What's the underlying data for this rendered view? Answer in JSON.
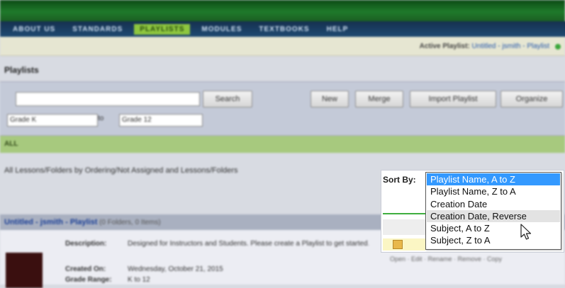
{
  "nav": {
    "items": [
      "ABOUT US",
      "STANDARDS",
      "PLAYLISTS",
      "MODULES",
      "TEXTBOOKS",
      "HELP"
    ],
    "active_index": 2
  },
  "statusbar": {
    "label": "Active Playlist:",
    "value": "Untitled - jsmith - Playlist"
  },
  "page": {
    "heading": "Playlists"
  },
  "search": {
    "input_value": "",
    "search_button": "Search",
    "buttons": [
      "New",
      "Merge",
      "Import Playlist",
      "Organize"
    ],
    "from_select": "Grade K",
    "to_word": "to",
    "to_select": "Grade 12"
  },
  "section": {
    "title": "ALL",
    "description": "All Lessons/Folders by Ordering/Not Assigned and Lessons/Folders"
  },
  "sort": {
    "label": "Sort By:",
    "options": [
      "Playlist Name, A to Z",
      "Playlist Name, Z to A",
      "Creation Date",
      "Creation Date, Reverse",
      "Subject, A to Z",
      "Subject, Z to A"
    ],
    "selected_index": 0,
    "hover_index": 3
  },
  "playlist": {
    "name": "Untitled - jsmith - Playlist",
    "meta": "(0 Folders, 0 Items)",
    "rows": [
      {
        "label": "Description:",
        "value": "Designed for Instructors and Students. Please create a Playlist to get started."
      },
      {
        "label": "Created On:",
        "value": "Wednesday, October 21, 2015"
      },
      {
        "label": "Grade Range:",
        "value": "K to 12"
      }
    ],
    "actions": "Open · Edit · Rename · Remove · Copy"
  },
  "colors": {
    "selected_option": "#3399ff",
    "hover_option": "#e3e3e3",
    "banner_green": "#1f7a2b",
    "nav_active": "#8ec63f"
  }
}
